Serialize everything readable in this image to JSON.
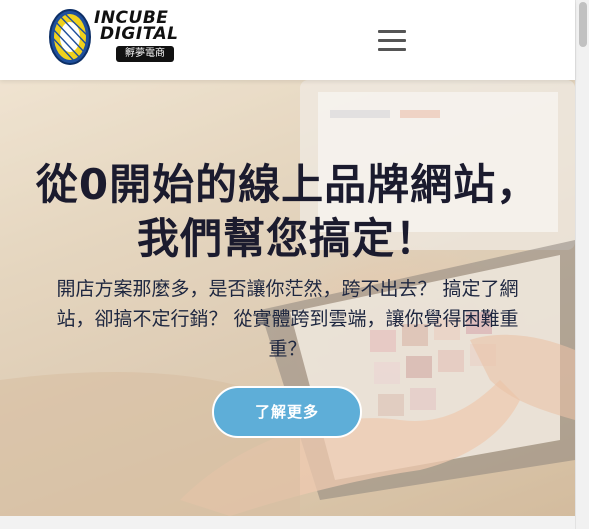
{
  "header": {
    "logo": {
      "word_line1": "INCUBE",
      "word_line2": "DIGITAL",
      "badge_text": "孵夢電商"
    },
    "menu_icon": "hamburger-menu-icon"
  },
  "hero": {
    "title": "從0開始的線上品牌網站， 我們幫您搞定！",
    "subtitle": "開店方案那麼多，是否讓你茫然，跨不出去？ 搞定了網站，卻搞不定行銷？ 從實體跨到雲端，讓你覺得困難重重？",
    "cta_label": "了解更多"
  },
  "colors": {
    "cta_background": "#5eaed8",
    "title_text": "#1b1b2e",
    "logo_yellow": "#f0d11c",
    "logo_blue": "#1f4f9c"
  }
}
